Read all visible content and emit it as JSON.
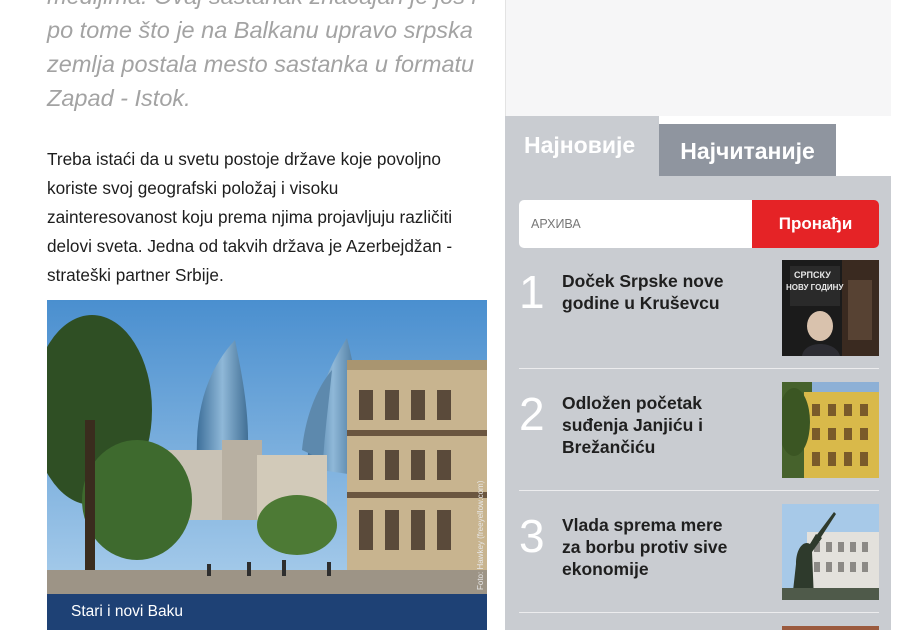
{
  "article": {
    "quote_lines": [
      "medijima. Ovaj sastanak značajan je još i",
      "po tome što je na Balkanu upravo srpska",
      "zemlja postala mesto sastanka u formatu",
      "Zapad - Istok."
    ],
    "body_lines": [
      "Treba istaći da u svetu postoje države koje povoljno",
      "koriste svoj geografski položaj i visoku",
      "zainteresovanost koju prema njima projavljuju različiti",
      "delovi sveta. Jedna od takvih država je Azerbejdžan -",
      "strateški partner Srbije."
    ],
    "photo_credit": "Foto: Hawkey (freeyellow.com)",
    "caption": "Stari i novi Baku"
  },
  "sidebar": {
    "tabs": {
      "latest": "Најновије",
      "popular": "Најчитаније"
    },
    "search": {
      "placeholder": "АРХИВА",
      "button": "Пронађи"
    },
    "news": [
      {
        "rank": "1",
        "title_lines": [
          "Doček Srpske nove",
          "godine u Kruševcu"
        ],
        "thumb_text_lines": [
          "СРПСКУ",
          "НОВУ ГОДИНУ"
        ]
      },
      {
        "rank": "2",
        "title_lines": [
          "Odložen početak",
          "suđenja Janjiću i",
          "Brežančiću"
        ]
      },
      {
        "rank": "3",
        "title_lines": [
          "Vlada sprema mere",
          "za borbu protiv sive",
          "ekonomije"
        ]
      }
    ]
  },
  "colors": {
    "panel": "#c9ccd1",
    "tab_inactive": "#8f959f",
    "search_button": "#e52326",
    "caption_bar": "#1e4175",
    "quote_text": "#a3a3a3"
  }
}
